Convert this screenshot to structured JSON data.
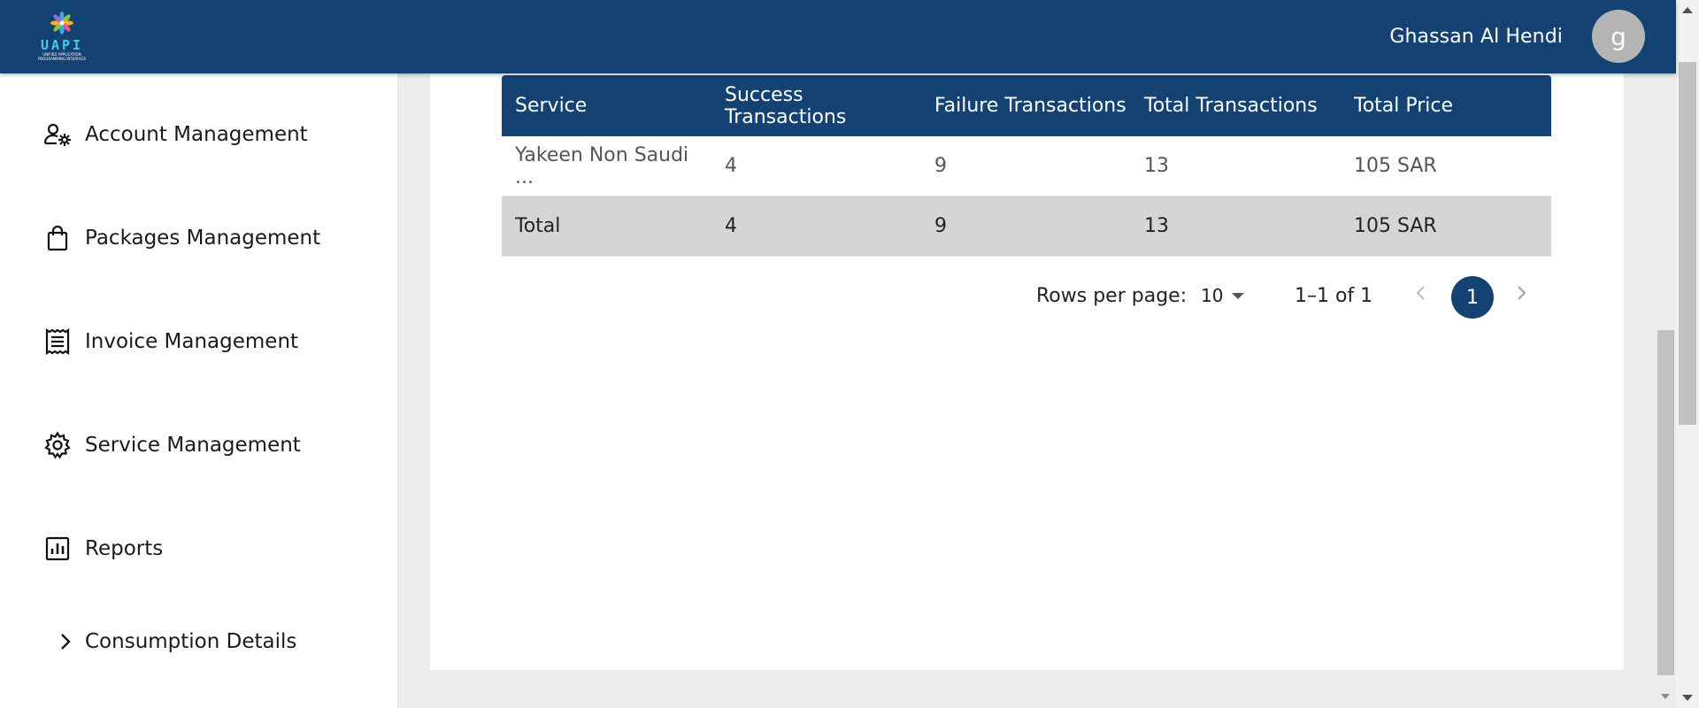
{
  "header": {
    "logo_text": "UAPI",
    "logo_subtext": "UNIFIED APPLICATION PROGRAMMING INTERFACE",
    "user_name": "Ghassan Al Hendi",
    "avatar_letter": "g"
  },
  "sidebar": {
    "items": [
      {
        "label": "Account Management",
        "icon": "user-gear-icon"
      },
      {
        "label": "Packages Management",
        "icon": "shopping-bag-icon"
      },
      {
        "label": "Invoice Management",
        "icon": "receipt-icon"
      },
      {
        "label": "Service Management",
        "icon": "gear-icon"
      },
      {
        "label": "Reports",
        "icon": "bar-chart-icon"
      },
      {
        "label": "Consumption Details",
        "icon": "chevron-right-icon"
      }
    ]
  },
  "table": {
    "columns": [
      "Service",
      "Success Transactions",
      "Failure Transactions",
      "Total Transactions",
      "Total Price"
    ],
    "rows": [
      [
        "Yakeen Non Saudi ...",
        "4",
        "9",
        "13",
        "105 SAR"
      ]
    ],
    "total_row": [
      "Total",
      "4",
      "9",
      "13",
      "105 SAR"
    ]
  },
  "pagination": {
    "rows_per_page_label": "Rows per page:",
    "rows_per_page_value": "10",
    "range_text": "1–1 of 1",
    "current_page": "1"
  },
  "colors": {
    "primary": "#144272",
    "total_row_bg": "#d5d5d5",
    "content_bg": "#ececec"
  }
}
